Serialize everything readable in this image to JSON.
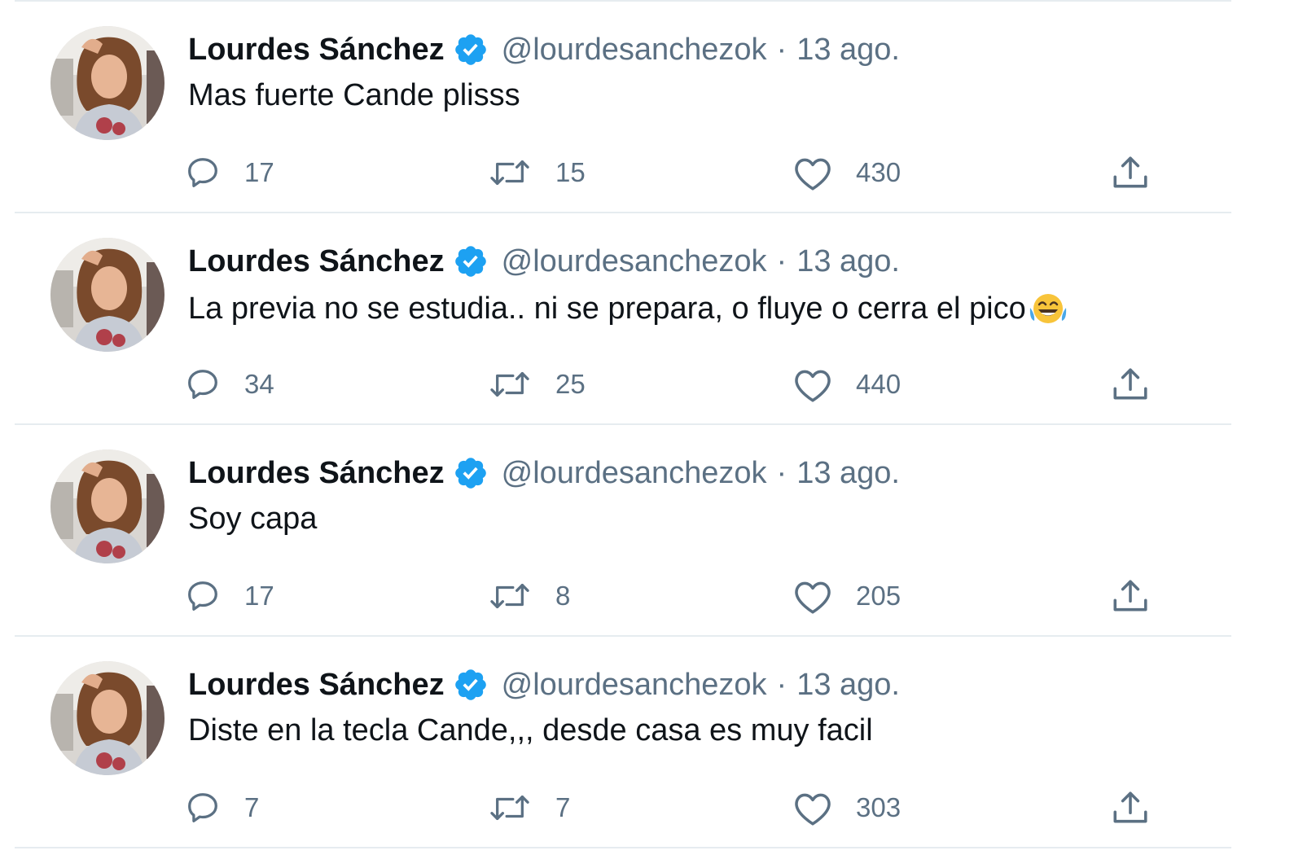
{
  "colors": {
    "verified": "#1da1f2",
    "secondary_text": "#5b7083",
    "primary_text": "#0f1419",
    "divider": "#e6ecf0"
  },
  "tweets": [
    {
      "name": "Lourdes Sánchez",
      "handle": "@lourdesanchezok",
      "separator": "·",
      "date": "13 ago.",
      "text": "Mas fuerte Cande plisss",
      "emoji": "",
      "replies": "17",
      "retweets": "15",
      "likes": "430"
    },
    {
      "name": "Lourdes Sánchez",
      "handle": "@lourdesanchezok",
      "separator": "·",
      "date": "13 ago.",
      "text": "La previa no se estudia.. ni se prepara, o fluye o cerra el pico",
      "emoji": "face-with-tears-of-joy-emoji",
      "replies": "34",
      "retweets": "25",
      "likes": "440"
    },
    {
      "name": "Lourdes Sánchez",
      "handle": "@lourdesanchezok",
      "separator": "·",
      "date": "13 ago.",
      "text": "Soy capa",
      "emoji": "",
      "replies": "17",
      "retweets": "8",
      "likes": "205"
    },
    {
      "name": "Lourdes Sánchez",
      "handle": "@lourdesanchezok",
      "separator": "·",
      "date": "13 ago.",
      "text": "Diste en la tecla Cande,,, desde casa es muy facil",
      "emoji": "",
      "replies": "7",
      "retweets": "7",
      "likes": "303"
    }
  ]
}
